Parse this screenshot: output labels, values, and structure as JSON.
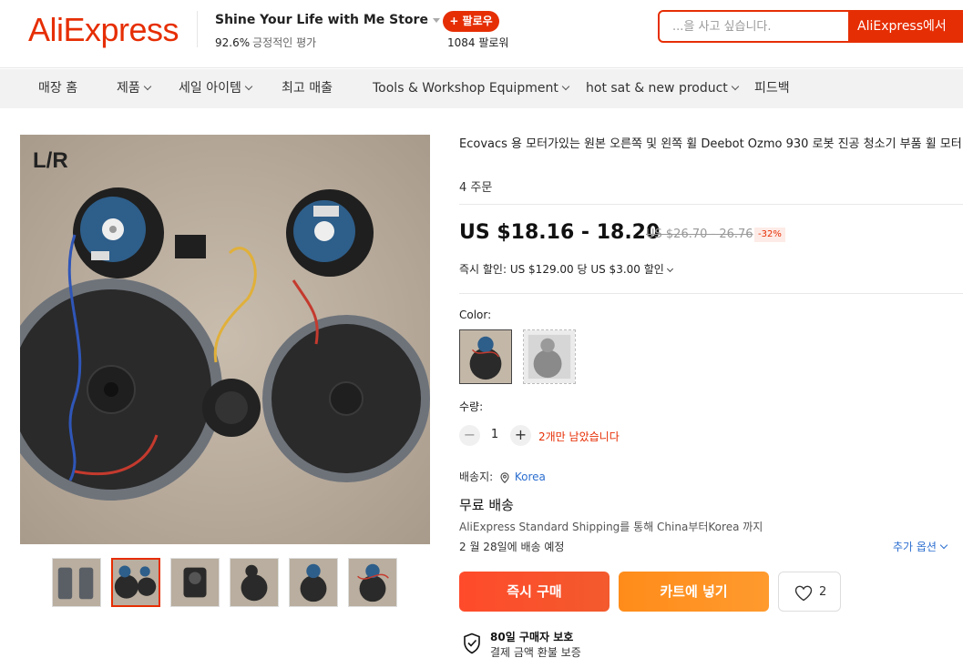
{
  "header": {
    "logo": "AliExpress",
    "store_name": "Shine Your Life with Me Store",
    "rating_value": "92.6%",
    "rating_label": "긍정적인 평가",
    "follow_label": "+ 팔로우",
    "followers": "1084 팔로워",
    "search_placeholder": "...을 사고 싶습니다.",
    "search_button": "AliExpress에서"
  },
  "nav": {
    "items": [
      {
        "label": "매장 홈",
        "has_dropdown": false
      },
      {
        "label": "제품",
        "has_dropdown": true
      },
      {
        "label": "세일 아이템",
        "has_dropdown": true
      },
      {
        "label": "최고 매출",
        "has_dropdown": false
      },
      {
        "label": "Tools & Workshop Equipment",
        "has_dropdown": true
      },
      {
        "label": "hot sat & new product",
        "has_dropdown": true
      },
      {
        "label": "피드백",
        "has_dropdown": false
      }
    ]
  },
  "gallery": {
    "main_image_label": "L/R",
    "thumbnail_count": 6,
    "active_thumbnail_index": 1
  },
  "product": {
    "title": "Ecovacs 용 모터가있는 원본 오른쪽 및 왼쪽 휠 Deebot Ozmo 930 로봇 진공 청소기 부품 휠 모터",
    "orders": "4 주문",
    "price": "US $18.16 - 18.20",
    "original_price": "US $26.70 - 26.76",
    "discount": "-32%",
    "promo": "즉시 할인: US $129.00 당 US $3.00 할인",
    "color_label": "Color:",
    "quantity_label": "수량:",
    "quantity_minus": "−",
    "quantity_value": "1",
    "quantity_plus": "+",
    "stock_message": "2개만 남았습니다"
  },
  "shipping": {
    "ship_to_label": "배송지:",
    "country": "Korea",
    "free_label": "무료 배송",
    "method": "AliExpress Standard Shipping를 통해 China부터Korea 까지",
    "delivery_date": "2 월 28일에 배송 예정",
    "more_options": "추가 옵션"
  },
  "actions": {
    "buy_now": "즉시 구매",
    "add_to_cart": "카트에 넣기",
    "wishlist_count": "2"
  },
  "protection": {
    "title": "80일 구매자 보호",
    "subtitle": "결제 금액 환불 보증"
  },
  "colors": {
    "brand": "#e62e04",
    "buy_button": "#ff4b2b",
    "cart_button": "#ff8c1a",
    "link": "#2d6fd0"
  }
}
